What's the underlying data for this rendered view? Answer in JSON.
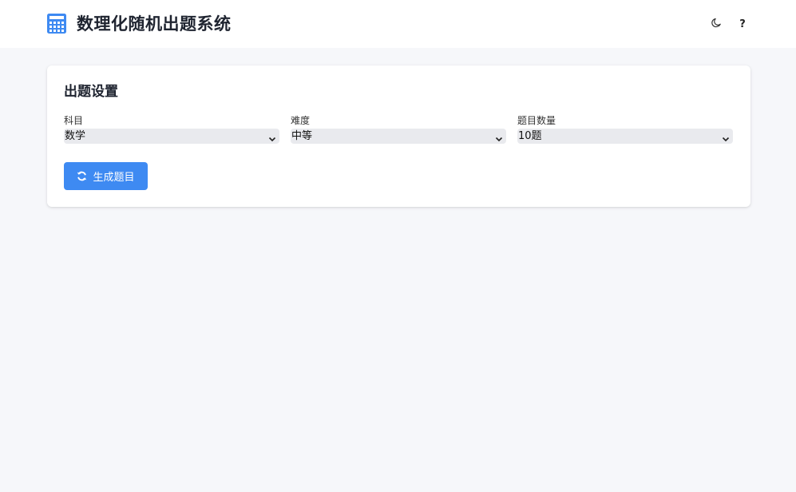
{
  "header": {
    "title": "数理化随机出题系统",
    "logo_icon": "calculator-icon",
    "theme_icon": "moon-icon",
    "help_label": "?"
  },
  "settings": {
    "title": "出题设置",
    "fields": [
      {
        "label": "科目",
        "value": "数学"
      },
      {
        "label": "难度",
        "value": "中等"
      },
      {
        "label": "题目数量",
        "value": "10题"
      }
    ],
    "generate_label": "生成题目",
    "generate_icon": "refresh-icon"
  },
  "colors": {
    "accent": "#3e8af2",
    "background": "#f6f7fa",
    "card": "#ffffff",
    "select_bg": "#e9eaee"
  }
}
